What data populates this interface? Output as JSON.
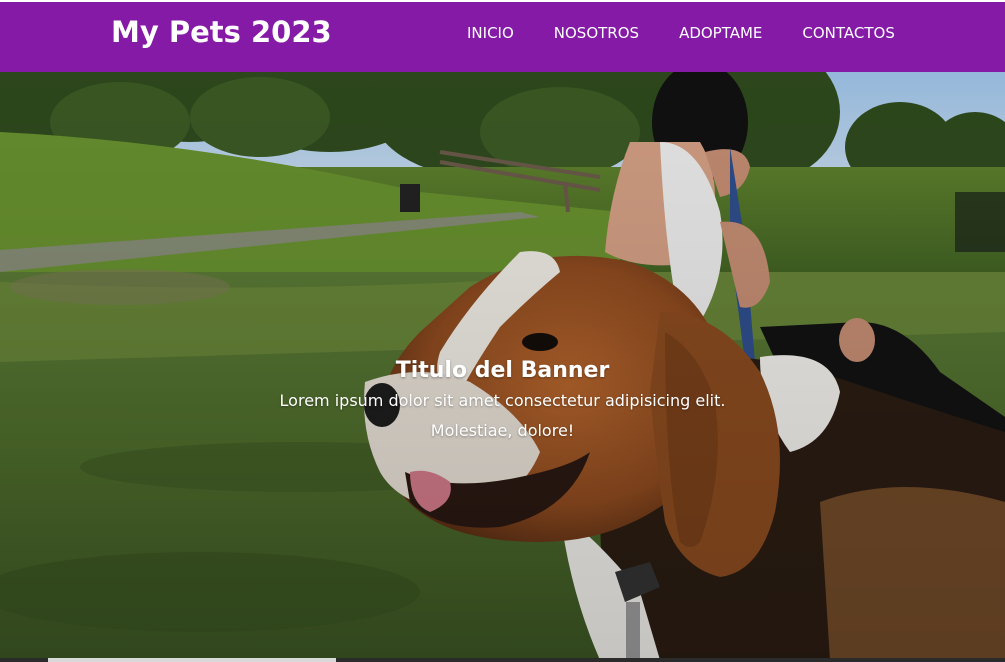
{
  "header": {
    "brand": "My Pets 2023",
    "nav": [
      {
        "label": "INICIO"
      },
      {
        "label": "NOSOTROS"
      },
      {
        "label": "ADOPTAME"
      },
      {
        "label": "CONTACTOS"
      }
    ]
  },
  "banner": {
    "title": "Titulo del Banner",
    "description": "Lorem ipsum dolor sit amet consectetur adipisicing elit. Molestiae, dolore!",
    "image": "photo of a beagle dog on grass in a park with a person holding its leash"
  },
  "colors": {
    "header_bg": "#851aa6",
    "text": "#ffffff"
  }
}
